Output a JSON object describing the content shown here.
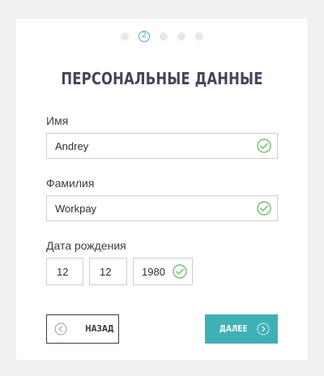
{
  "progress": {
    "current_step_label": "2",
    "step_count": 5,
    "current_step_index": 1
  },
  "form": {
    "title": "ПЕРСОНАЛЬНЫЕ ДАННЫЕ",
    "first_name": {
      "label": "Имя",
      "value": "Andrey"
    },
    "last_name": {
      "label": "Фамилия",
      "value": "Workpay"
    },
    "birth_date": {
      "label": "Дата рождения",
      "day": "12",
      "month": "12",
      "year": "1980"
    }
  },
  "buttons": {
    "back_label": "НАЗАД",
    "next_label": "ДАЛЕЕ"
  },
  "colors": {
    "accent": "#3fb1b6",
    "valid_check": "#6cc36a",
    "background": "#f1f1f3",
    "card": "#ffffff",
    "text": "#3d3d45"
  },
  "icons": {
    "valid": "check-circle-icon",
    "back": "chevron-left-circle-icon",
    "next": "chevron-right-circle-icon"
  }
}
